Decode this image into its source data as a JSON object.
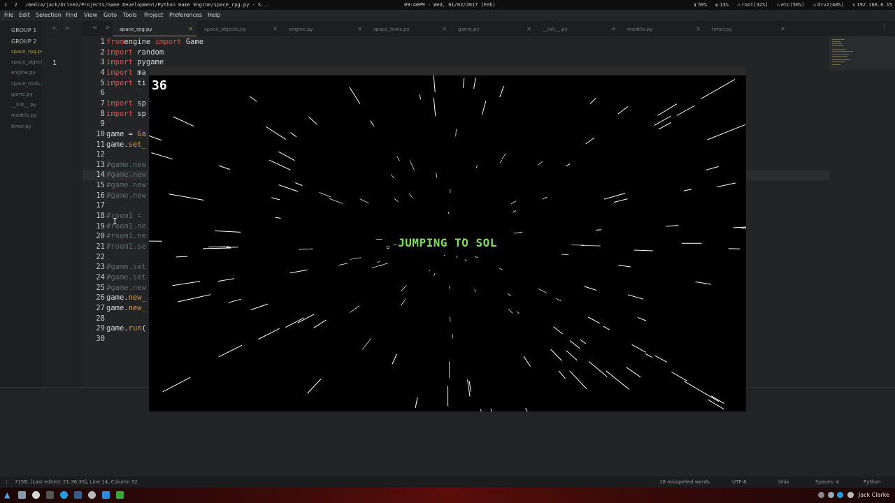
{
  "system_bar": {
    "workspaces": [
      "1",
      "2"
    ],
    "window_title": "/media/jack/Drive2/Projects/Game Development/Python Game Engine/space_rpg.py - S...",
    "clock": "09:40PM - Wed, 01/02/2017 (Feb)",
    "stats": [
      "59%",
      "13%",
      "root(32%)",
      "etc(56%)",
      "drv2(48%)",
      "192.168.0.15"
    ]
  },
  "menu": [
    "File",
    "Edit",
    "Selection",
    "Find",
    "View",
    "Goto",
    "Tools",
    "Project",
    "Preferences",
    "Help"
  ],
  "sidebar": {
    "groups": [
      "GROUP 1",
      "GROUP 2"
    ],
    "files": [
      "space_rpg.py",
      "space_objects.py",
      "engine.py",
      "space_tools.py",
      "game.py",
      "__init__.py",
      "models.py",
      "timer.py"
    ]
  },
  "group1": {
    "line_number": "1"
  },
  "tabs": [
    {
      "label": "space_rpg.py",
      "active": true
    },
    {
      "label": "space_objects.py"
    },
    {
      "label": "engine.py"
    },
    {
      "label": "space_tools.py"
    },
    {
      "label": "game.py"
    },
    {
      "label": "__init__.py"
    },
    {
      "label": "models.py"
    },
    {
      "label": "timer.py"
    }
  ],
  "code": [
    {
      "n": "1",
      "parts": [
        [
          "kw",
          "from"
        ],
        [
          "",
          "engine "
        ],
        [
          "kw",
          "import"
        ],
        [
          "",
          " Game"
        ]
      ]
    },
    {
      "n": "2",
      "parts": [
        [
          "kw",
          "import"
        ],
        [
          "",
          " random"
        ]
      ]
    },
    {
      "n": "3",
      "parts": [
        [
          "kw",
          "import"
        ],
        [
          "",
          " pygame"
        ]
      ]
    },
    {
      "n": "4",
      "parts": [
        [
          "kw",
          "import"
        ],
        [
          "",
          " ma"
        ]
      ]
    },
    {
      "n": "5",
      "parts": [
        [
          "kw",
          "import"
        ],
        [
          "",
          " ti"
        ]
      ]
    },
    {
      "n": "6",
      "parts": []
    },
    {
      "n": "7",
      "parts": [
        [
          "kw",
          "import"
        ],
        [
          "",
          " sp"
        ]
      ]
    },
    {
      "n": "8",
      "parts": [
        [
          "kw",
          "import"
        ],
        [
          "",
          " sp"
        ]
      ]
    },
    {
      "n": "9",
      "parts": []
    },
    {
      "n": "10",
      "parts": [
        [
          "",
          "game = "
        ],
        [
          "fn",
          "Ga"
        ]
      ]
    },
    {
      "n": "11",
      "parts": [
        [
          "",
          "game."
        ],
        [
          "fn",
          "set_"
        ]
      ]
    },
    {
      "n": "12",
      "parts": []
    },
    {
      "n": "13",
      "parts": [
        [
          "cm",
          "#game.new"
        ]
      ]
    },
    {
      "n": "14",
      "parts": [
        [
          "cm",
          "#game.new"
        ]
      ]
    },
    {
      "n": "15",
      "parts": [
        [
          "cm",
          "#game.new"
        ]
      ]
    },
    {
      "n": "16",
      "parts": [
        [
          "cm",
          "#game.new"
        ]
      ]
    },
    {
      "n": "17",
      "parts": []
    },
    {
      "n": "18",
      "parts": [
        [
          "cm",
          "#room1 ="
        ]
      ]
    },
    {
      "n": "19",
      "parts": [
        [
          "cm",
          "#room1.ne"
        ]
      ]
    },
    {
      "n": "20",
      "parts": [
        [
          "cm",
          "#room1.ne"
        ]
      ]
    },
    {
      "n": "21",
      "parts": [
        [
          "cm",
          "#room1.se"
        ]
      ]
    },
    {
      "n": "22",
      "parts": []
    },
    {
      "n": "23",
      "parts": [
        [
          "cm",
          "#game.set"
        ]
      ]
    },
    {
      "n": "24",
      "parts": [
        [
          "cm",
          "#game.set"
        ]
      ]
    },
    {
      "n": "25",
      "parts": [
        [
          "cm",
          "#game.new"
        ]
      ]
    },
    {
      "n": "26",
      "parts": [
        [
          "",
          "game."
        ],
        [
          "fn",
          "new_"
        ]
      ]
    },
    {
      "n": "27",
      "parts": [
        [
          "",
          "game."
        ],
        [
          "fn",
          "new_"
        ]
      ]
    },
    {
      "n": "28",
      "parts": []
    },
    {
      "n": "29",
      "parts": [
        [
          "",
          "game."
        ],
        [
          "fn",
          "run"
        ],
        [
          "",
          "("
        ]
      ]
    },
    {
      "n": "30",
      "parts": []
    }
  ],
  "game": {
    "score": "36",
    "message": "JUMPING TO SOL"
  },
  "status_bar": {
    "info": "715B, [Last edited: 21:36:39], Line 14, Column 32",
    "spelling": "18 misspelled words",
    "encoding": "UTF-8",
    "line_endings": "Unix",
    "indent": "Spaces: 4",
    "syntax": "Python"
  },
  "taskbar": {
    "user": "Jack Clarke"
  },
  "colors": {
    "keyword": "#e05050",
    "comment": "#5e6a6a",
    "function": "#d59a4f",
    "accent": "#9e9e3a",
    "game_text": "#7de05a"
  }
}
